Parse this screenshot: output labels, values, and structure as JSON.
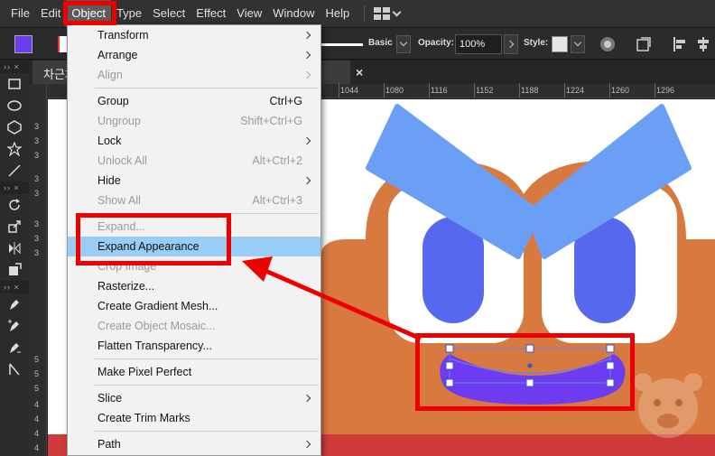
{
  "menubar": {
    "items": [
      "File",
      "Edit",
      "Object",
      "Type",
      "Select",
      "Effect",
      "View",
      "Window",
      "Help"
    ],
    "active_item": "Object"
  },
  "controlbar": {
    "brush_label": "Basic",
    "opacity_label": "Opacity:",
    "opacity_value": "100%",
    "style_label": "Style:",
    "fill_color": "#6e3cf0"
  },
  "document_tab": {
    "title": "차근차",
    "close_label": "×"
  },
  "rulers": {
    "top_labels": [
      "1044",
      "1080",
      "1116",
      "1152",
      "1188",
      "1224",
      "1260",
      "1296"
    ],
    "left_labels": [
      "3",
      "3",
      "3",
      "3",
      "3",
      "3",
      "3",
      "3",
      "5",
      "5",
      "5",
      "4",
      "4",
      "4",
      "4"
    ]
  },
  "object_menu": {
    "transform": "Transform",
    "arrange": "Arrange",
    "align": "Align",
    "group": "Group",
    "group_shortcut": "Ctrl+G",
    "ungroup": "Ungroup",
    "ungroup_shortcut": "Shift+Ctrl+G",
    "lock": "Lock",
    "unlock_all": "Unlock All",
    "unlock_all_shortcut": "Alt+Ctrl+2",
    "hide": "Hide",
    "show_all": "Show All",
    "show_all_shortcut": "Alt+Ctrl+3",
    "expand": "Expand...",
    "expand_appearance": "Expand Appearance",
    "crop_image": "Crop Image",
    "rasterize": "Rasterize...",
    "create_gradient_mesh": "Create Gradient Mesh...",
    "create_object_mosaic": "Create Object Mosaic...",
    "flatten_transparency": "Flatten Transparency...",
    "make_pixel_perfect": "Make Pixel Perfect",
    "slice": "Slice",
    "create_trim_marks": "Create Trim Marks",
    "path": "Path"
  },
  "colors": {
    "annotation_red": "#ee0000",
    "menu_highlight": "#99cdf5",
    "character_orange": "#d8793f",
    "eye_blue": "#5669ee",
    "brow_blue": "#6b9ef5",
    "mouth_purple": "#6e3cf0",
    "banner_red": "#cf3b3b"
  }
}
